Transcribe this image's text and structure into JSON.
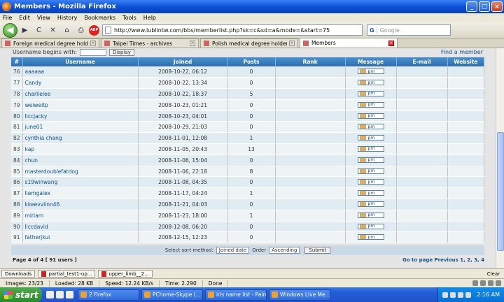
{
  "window": {
    "title": "Members - Mozilla Firefox",
    "minimize": "_",
    "maximize": "□",
    "close": "×"
  },
  "menu": [
    "File",
    "Edit",
    "View",
    "History",
    "Bookmarks",
    "Tools",
    "Help"
  ],
  "nav": {
    "url": "http://www.lublintw.com/bbs/memberlist.php?sk=c&sd=a&mode=&start=75",
    "search_placeholder": "Google",
    "search_engine": "G",
    "abp_label": "ABP",
    "reload": "C",
    "stop": "✕",
    "home": "⌂",
    "print": "⎙",
    "back": "◀",
    "forward": "▶"
  },
  "tabs": [
    {
      "label": "Foreign medical degree holders ...",
      "close": "×"
    },
    {
      "label": "Taipei Times - archives",
      "close": "×"
    },
    {
      "label": "Polish medical degree holders a...",
      "close": "×"
    },
    {
      "label": "Members",
      "close": "×"
    }
  ],
  "filter": {
    "label": "Username begins with:",
    "button": "Display",
    "find": "Find a member"
  },
  "table": {
    "headers": [
      "#",
      "Username",
      "Joined",
      "Posts",
      "Rank",
      "Message",
      "E-mail",
      "Website"
    ],
    "pm_label": "pm",
    "rows": [
      {
        "num": "76",
        "username": "aaaaaa",
        "joined": "2008-10-22, 06:12",
        "posts": "0"
      },
      {
        "num": "77",
        "username": "Candy",
        "joined": "2008-10-22, 13:34",
        "posts": "0"
      },
      {
        "num": "78",
        "username": "charlielee",
        "joined": "2008-10-22, 18:37",
        "posts": "5"
      },
      {
        "num": "79",
        "username": "weiweitp",
        "joined": "2008-10-23, 01:21",
        "posts": "0"
      },
      {
        "num": "80",
        "username": "liccjacky",
        "joined": "2008-10-23, 04:01",
        "posts": "0"
      },
      {
        "num": "81",
        "username": "june01",
        "joined": "2008-10-29, 21:03",
        "posts": "0"
      },
      {
        "num": "82",
        "username": "cynthia chang",
        "joined": "2008-11-01, 12:08",
        "posts": "1"
      },
      {
        "num": "83",
        "username": "kap",
        "joined": "2008-11-05, 20:43",
        "posts": "13"
      },
      {
        "num": "84",
        "username": "chun",
        "joined": "2008-11-06, 15:04",
        "posts": "0"
      },
      {
        "num": "85",
        "username": "masterdoublefatdog",
        "joined": "2008-11-06, 22:18",
        "posts": "8"
      },
      {
        "num": "86",
        "username": "s19winwang",
        "joined": "2008-11-08, 04:35",
        "posts": "0"
      },
      {
        "num": "87",
        "username": "liemgalex",
        "joined": "2008-11-17, 04:24",
        "posts": "1"
      },
      {
        "num": "88",
        "username": "kkeevviinn46",
        "joined": "2008-11-21, 04:03",
        "posts": "0"
      },
      {
        "num": "89",
        "username": "miriam",
        "joined": "2008-11-23, 18:00",
        "posts": "1"
      },
      {
        "num": "90",
        "username": "liccdavid",
        "joined": "2008-12-08, 06:20",
        "posts": "0"
      },
      {
        "num": "91",
        "username": "fatherjkui",
        "joined": "2008-12-15, 12:23",
        "posts": "0"
      }
    ]
  },
  "sort": {
    "method_label": "Select sort method:",
    "method_value": "Joined date",
    "order_label": "Order",
    "order_value": "Ascending",
    "submit": "Submit"
  },
  "pagination": {
    "info": "Page 4 of 4 [ 91 users ]",
    "goto": "Go to page Previous 1, 2, 3, 4"
  },
  "downloads": {
    "label": "Downloads",
    "items": [
      "partial_test1-up...",
      "upper_limb__2..."
    ],
    "clear": "Clear"
  },
  "status": {
    "images": "Images: 23/23",
    "loaded": "Loaded: 28 KB",
    "speed": "Speed: 12.24 KB/s",
    "time": "Time: 2.290",
    "done": "Done"
  },
  "taskbar": {
    "start": "start",
    "tasks": [
      "2 Firefox",
      "PChome-Skype (...",
      "iris name list - Paint",
      "Windows Live Me..."
    ],
    "clock": "2:16 AM"
  }
}
